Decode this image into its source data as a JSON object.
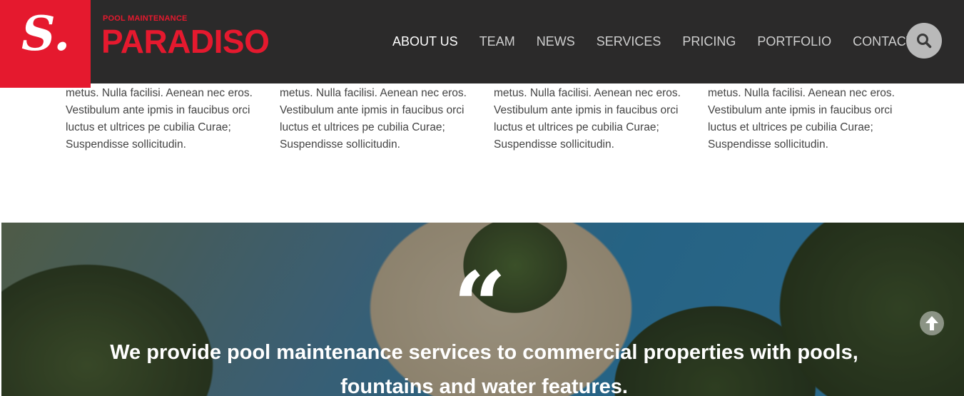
{
  "header": {
    "logo_letter": "S.",
    "brand_sub": "POOL MAINTENANCE",
    "brand_name": "PARADISO",
    "nav": [
      "ABOUT US",
      "TEAM",
      "NEWS",
      "SERVICES",
      "PRICING",
      "PORTFOLIO",
      "CONTACTS"
    ],
    "active_nav": "ABOUT US",
    "search_icon": "search-icon"
  },
  "columns": [
    {
      "lines": [
        "metus. Nulla facilisi. Aenean nec eros.",
        "Vestibulum ante ipmis in faucibus orci",
        "luctus et ultrices pe cubilia Curae;",
        "Suspendisse sollicitudin."
      ]
    },
    {
      "lines": [
        "metus. Nulla facilisi. Aenean nec eros.",
        "Vestibulum ante ipmis in faucibus orci",
        "luctus et ultrices pe cubilia Curae;",
        "Suspendisse sollicitudin."
      ]
    },
    {
      "lines": [
        "metus. Nulla facilisi. Aenean nec eros.",
        "Vestibulum ante ipmis in faucibus orci",
        "luctus et ultrices pe cubilia Curae;",
        "Suspendisse sollicitudin."
      ]
    },
    {
      "lines": [
        "metus. Nulla facilisi. Aenean nec eros.",
        "Vestibulum ante ipmis in faucibus orci",
        "luctus et ultrices pe cubilia Curae;",
        "Suspendisse sollicitudin."
      ]
    }
  ],
  "testimonial": {
    "quote_mark": "“",
    "text": "We provide pool maintenance services to commercial properties with pools, fountains and water features."
  },
  "colors": {
    "brand_red": "#e5192e",
    "header_bg": "#2b2a2a"
  },
  "icons": {
    "scroll_up": "arrow-up-circle-icon"
  }
}
